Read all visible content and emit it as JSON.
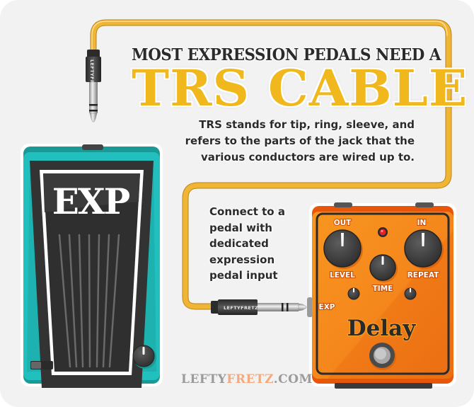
{
  "headline": {
    "line1": "MOST EXPRESSION PEDALS NEED A",
    "line2": "TRS CABLE"
  },
  "description": {
    "line1": "TRS stands for tip, ring, sleeve, and",
    "line2": "refers to the parts of the jack that the",
    "line3": "various conductors are wired up to."
  },
  "connect_note": {
    "lines": [
      "Connect to a",
      "pedal with",
      "dedicated",
      "expression",
      "pedal input"
    ]
  },
  "expression_pedal": {
    "label": "EXP",
    "color": "#1fbfbf"
  },
  "delay_pedal": {
    "name": "Delay",
    "color": "#f58a1f",
    "jack_labels": {
      "out": "OUT",
      "in": "IN",
      "exp": "EXP"
    },
    "knob_labels": {
      "level": "LEVEL",
      "time": "TIME",
      "repeat": "REPEAT"
    },
    "led_color": "#e8202a"
  },
  "cable": {
    "color": "#f0b532",
    "plug_brand": "LEFTYFRETZ"
  },
  "footer": {
    "site_part1": "LEFTY",
    "site_part2": "FRETZ",
    "site_part3": ".COM"
  }
}
